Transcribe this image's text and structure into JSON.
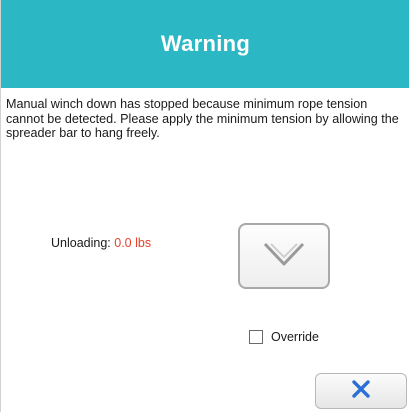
{
  "dialog": {
    "title": "Warning",
    "message": "Manual winch down has stopped because minimum rope tension cannot be detected. Please apply the minimum tension by allowing the spreader bar to hang freely.",
    "unloading_label": "Unloading:",
    "unloading_value": "0.0",
    "unloading_unit": "lbs",
    "down_button_icon": "chevron-down-icon",
    "override_label": "Override",
    "override_checked": false,
    "close_button_icon": "close-icon"
  },
  "colors": {
    "header": "#2bb7c4",
    "value": "#e8412a",
    "close_icon": "#2a6fd6"
  }
}
